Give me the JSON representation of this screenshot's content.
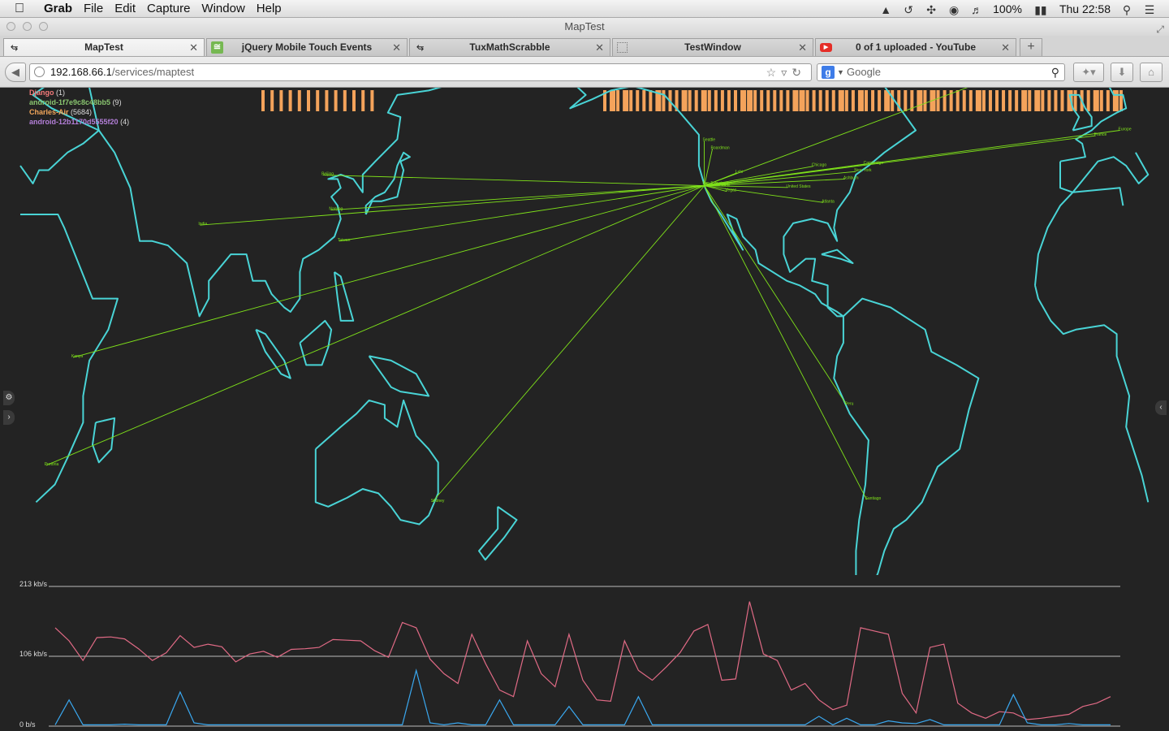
{
  "menubar": {
    "app": "Grab",
    "menus": [
      "File",
      "Edit",
      "Capture",
      "Window",
      "Help"
    ],
    "battery": "100%",
    "clock": "Thu 22:58"
  },
  "window": {
    "title": "MapTest"
  },
  "tabs": [
    {
      "label": "MapTest",
      "active": true
    },
    {
      "label": "jQuery Mobile Touch Events",
      "active": false
    },
    {
      "label": "TuxMathScrabble",
      "active": false
    },
    {
      "label": "TestWindow",
      "active": false
    },
    {
      "label": "0 of 1 uploaded - YouTube",
      "active": false
    }
  ],
  "newtab_label": "+",
  "url": {
    "host": "192.168.66.1",
    "path": "/services/maptest"
  },
  "search": {
    "placeholder": "Google"
  },
  "legend": [
    {
      "name": "Django",
      "count": "(1)",
      "color": "#f27a7a"
    },
    {
      "name": "android-1f7e9c8c48bb5",
      "count": "(9)",
      "color": "#89c56f"
    },
    {
      "name": "Charles-Air",
      "count": "(5684)",
      "color": "#f1a65a"
    },
    {
      "name": "android-12b1170d5555f20",
      "count": "(4)",
      "color": "#b47fd9"
    }
  ],
  "colors": {
    "coast": "#49d4d6",
    "link": "#7fe21a",
    "bars": "#f4a35b",
    "series_pink": "#e06a85",
    "series_blue": "#3aa8f0"
  },
  "hub": {
    "name": "San Carlos"
  },
  "cities": [
    {
      "name": "Beijing",
      "lon": 116.4,
      "lat": 39.9,
      "link": true
    },
    {
      "name": "Taiwan",
      "lon": 121.5,
      "lat": 25.0,
      "link": true
    },
    {
      "name": "Nanjing",
      "lon": 118.8,
      "lat": 32.0,
      "link": true
    },
    {
      "name": "India",
      "lon": 77.2,
      "lat": 28.6,
      "link": true
    },
    {
      "name": "Sydney",
      "lon": 151.2,
      "lat": -33.9,
      "link": true
    },
    {
      "name": "Iceland",
      "lon": -21.9,
      "lat": 64.1,
      "link": true
    },
    {
      "name": "France",
      "lon": 2.3,
      "lat": 48.8,
      "link": true
    },
    {
      "name": "Europe",
      "lon": 10.0,
      "lat": 50.0,
      "link": true
    },
    {
      "name": "Kenya",
      "lon": 36.8,
      "lat": -1.3,
      "link": true
    },
    {
      "name": "Pretoria",
      "lon": 28.2,
      "lat": -25.7,
      "link": true
    },
    {
      "name": "Peru",
      "lon": -77.0,
      "lat": -12.0,
      "link": true
    },
    {
      "name": "Santiago",
      "lon": -70.6,
      "lat": -33.4,
      "link": true
    },
    {
      "name": "Seattle",
      "lon": -122.3,
      "lat": 47.6,
      "link": true
    },
    {
      "name": "Boardman",
      "lon": -119.7,
      "lat": 45.8,
      "link": true
    },
    {
      "name": "Lehi",
      "lon": -111.9,
      "lat": 40.4,
      "link": true
    },
    {
      "name": "Chicago",
      "lon": -87.6,
      "lat": 41.9,
      "link": true
    },
    {
      "name": "United States",
      "lon": -95.7,
      "lat": 37.1,
      "link": true
    },
    {
      "name": "Ashburn",
      "lon": -77.5,
      "lat": 39.0,
      "link": true
    },
    {
      "name": "New York",
      "lon": -74.0,
      "lat": 40.7,
      "link": true
    },
    {
      "name": "Cambridge",
      "lon": -71.1,
      "lat": 42.4,
      "link": true
    },
    {
      "name": "Atlanta",
      "lon": -84.4,
      "lat": 33.7,
      "link": true
    },
    {
      "name": "Vegas",
      "lon": -115.1,
      "lat": 36.2,
      "link": true
    },
    {
      "name": "San Francisco",
      "lon": -122.4,
      "lat": 37.8,
      "link": true
    },
    {
      "name": "Mountain View",
      "lon": -122.1,
      "lat": 37.4,
      "link": true
    }
  ],
  "traffic_bars": {
    "groups": [
      {
        "count": 13
      },
      {
        "count": 80
      }
    ]
  },
  "throughput": {
    "y_labels": [
      "213 kb/s",
      "106 kb/s",
      "0 b/s"
    ],
    "ymax": 213,
    "series": [
      {
        "color": "#e06a85",
        "values": [
          150,
          130,
          100,
          135,
          136,
          133,
          118,
          100,
          112,
          138,
          120,
          125,
          121,
          98,
          110,
          114,
          105,
          117,
          118,
          120,
          132,
          131,
          130,
          115,
          105,
          158,
          150,
          102,
          80,
          65,
          140,
          95,
          55,
          45,
          130,
          80,
          60,
          140,
          70,
          40,
          38,
          130,
          85,
          70,
          90,
          112,
          145,
          155,
          70,
          72,
          190,
          110,
          100,
          55,
          65,
          40,
          25,
          32,
          150,
          145,
          140,
          50,
          20,
          120,
          125,
          35,
          20,
          12,
          22,
          20,
          10,
          12,
          15,
          18,
          30,
          35,
          45
        ]
      },
      {
        "color": "#3aa8f0",
        "values": [
          2,
          40,
          2,
          2,
          2,
          3,
          2,
          2,
          2,
          52,
          5,
          2,
          2,
          2,
          2,
          2,
          2,
          2,
          2,
          2,
          2,
          2,
          2,
          2,
          2,
          2,
          85,
          5,
          2,
          5,
          2,
          2,
          40,
          2,
          2,
          2,
          2,
          30,
          2,
          2,
          2,
          2,
          45,
          2,
          2,
          2,
          2,
          2,
          2,
          2,
          2,
          2,
          2,
          2,
          2,
          15,
          2,
          12,
          2,
          2,
          8,
          5,
          4,
          10,
          2,
          2,
          2,
          2,
          2,
          48,
          5,
          2,
          2,
          4,
          2,
          2,
          2
        ]
      }
    ]
  }
}
